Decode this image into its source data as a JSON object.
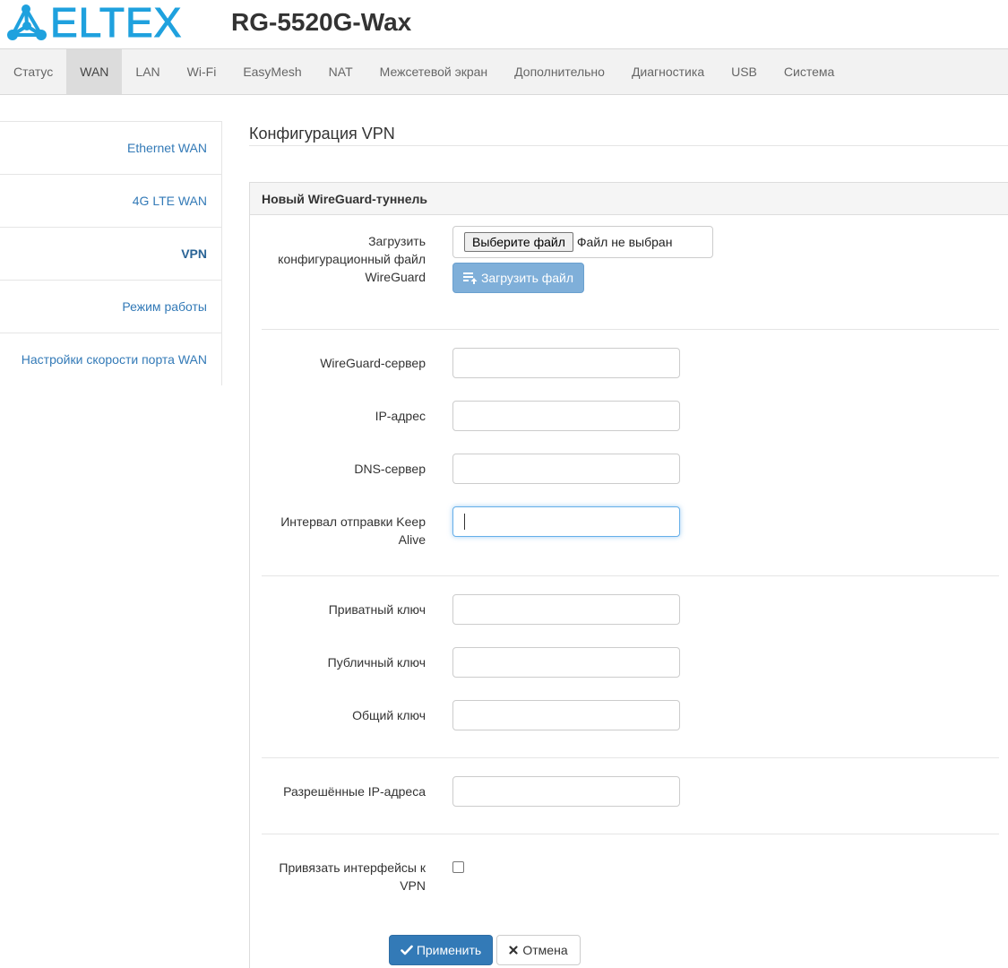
{
  "header": {
    "logo_text": "ELTEX",
    "device_title": "RG-5520G-Wax",
    "brand_color": "#1fa1de"
  },
  "topnav": {
    "tabs": [
      {
        "label": "Статус"
      },
      {
        "label": "WAN",
        "active": true
      },
      {
        "label": "LAN"
      },
      {
        "label": "Wi-Fi"
      },
      {
        "label": "EasyMesh"
      },
      {
        "label": "NAT"
      },
      {
        "label": "Межсетевой экран"
      },
      {
        "label": "Дополнительно"
      },
      {
        "label": "Диагностика"
      },
      {
        "label": "USB"
      },
      {
        "label": "Система"
      }
    ]
  },
  "sidebar": {
    "items": [
      {
        "label": "Ethernet WAN"
      },
      {
        "label": "4G LTE WAN"
      },
      {
        "label": "VPN",
        "active": true
      },
      {
        "label": "Режим работы"
      },
      {
        "label": "Настройки скорости порта WAN"
      }
    ]
  },
  "main": {
    "page_title": "Конфигурация VPN",
    "panel_title": "Новый WireGuard-туннель",
    "upload": {
      "label": "Загрузить конфигурационный файл WireGuard",
      "choose_button": "Выберите файл",
      "file_status": "Файл не выбран",
      "upload_button": "Загрузить файл"
    },
    "fields": {
      "server": {
        "label": "WireGuard-сервер",
        "value": ""
      },
      "ip": {
        "label": "IP-адрес",
        "value": ""
      },
      "dns": {
        "label": "DNS-сервер",
        "value": ""
      },
      "keepalive": {
        "label": "Интервал отправки Keep Alive",
        "value": ""
      },
      "private_key": {
        "label": "Приватный ключ",
        "value": ""
      },
      "public_key": {
        "label": "Публичный ключ",
        "value": ""
      },
      "shared_key": {
        "label": "Общий ключ",
        "value": ""
      },
      "allowed_ips": {
        "label": "Разрешённые IP-адреса",
        "value": ""
      }
    },
    "bind_interfaces": {
      "label": "Привязать интерфейсы к VPN",
      "checked": false
    },
    "buttons": {
      "apply": "Применить",
      "cancel": "Отмена"
    },
    "colors": {
      "primary": "#337ab7",
      "upload_button": "#7fafd9",
      "link": "#337ab7"
    }
  }
}
